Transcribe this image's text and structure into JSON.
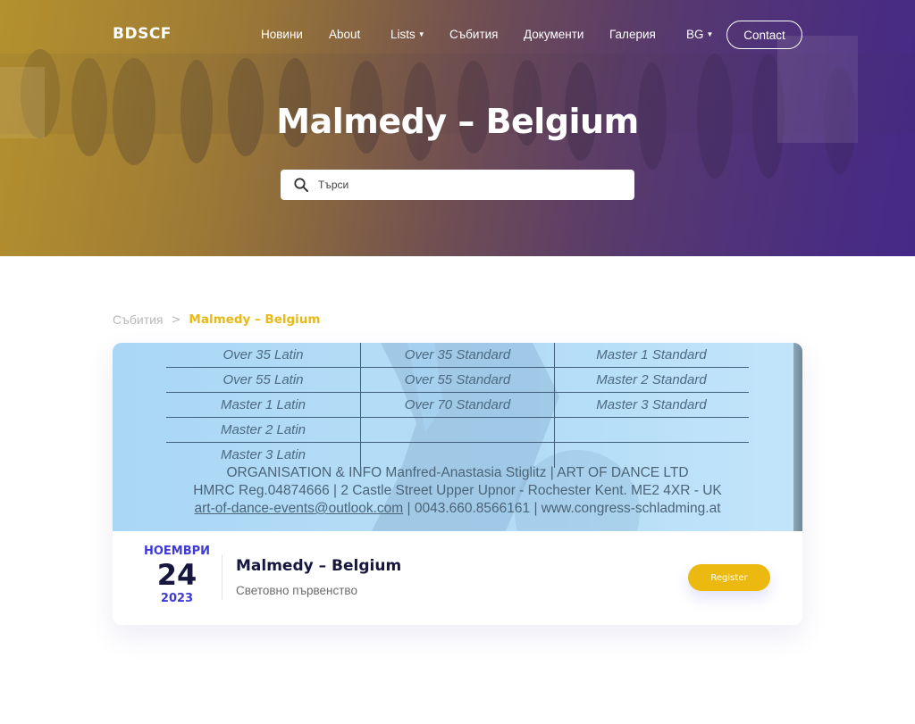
{
  "header": {
    "logo": "BDSCF",
    "nav": [
      {
        "label": "Новини",
        "has_dropdown": false
      },
      {
        "label": "About",
        "has_dropdown": false
      },
      {
        "label": "Lists",
        "has_dropdown": true
      },
      {
        "label": "Събития",
        "has_dropdown": false
      },
      {
        "label": "Документи",
        "has_dropdown": false
      },
      {
        "label": "Галерия",
        "has_dropdown": false
      },
      {
        "label": "BG",
        "has_dropdown": true
      }
    ],
    "contact_label": "Contact",
    "dropdown_icon": "chevron-down-icon"
  },
  "hero": {
    "title": "Malmedy – Belgium",
    "search": {
      "placeholder": "Търси",
      "value": "",
      "icon": "search-icon"
    }
  },
  "breadcrumb": {
    "parent": "Събития",
    "separator": ">",
    "current": "Malmedy – Belgium"
  },
  "event": {
    "poster": {
      "rows": [
        [
          "Over 35 Latin",
          "Over 35 Standard",
          "Master 1 Standard"
        ],
        [
          "Over 55 Latin",
          "Over 55 Standard",
          "Master 2 Standard"
        ],
        [
          "Master 1 Latin",
          "Over 70 Standard",
          "Master 3 Standard"
        ],
        [
          "Master 2 Latin",
          "",
          ""
        ],
        [
          "Master 3 Latin",
          "",
          ""
        ]
      ],
      "info_line_1": "ORGANISATION & INFO Manfred-Anastasia Stiglitz | ART OF DANCE LTD",
      "info_line_2": "HMRC Reg.04874666 | 2 Castle Street Upper Upnor - Rochester Kent. ME2 4XR - UK",
      "info_email": "art-of-dance-events@outlook.com",
      "info_line_3_rest": " | 0043.660.8566161 | www.congress-schladming.at"
    },
    "date": {
      "month": "НОЕМВРИ",
      "day": "24",
      "year": "2023"
    },
    "title": "Malmedy – Belgium",
    "subtitle": "Световно първенство",
    "register_label": "Register"
  },
  "colors": {
    "accent_yellow": "#ebb90f",
    "date_blue": "#3d3ad6",
    "title_navy": "#16163f"
  }
}
